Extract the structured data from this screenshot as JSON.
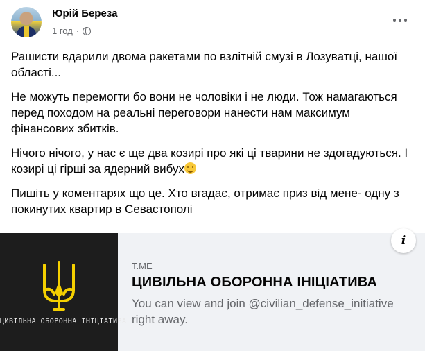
{
  "post": {
    "author": "Юрій Береза",
    "time": "1 год",
    "dot": "·",
    "paragraphs": [
      "Рашисти вдарили двома ракетами по взлітній смузі в Лозуватці, нашої області...",
      "Не можуть перемогти бо вони не чоловіки і не люди. Тож намагаються перед походом на реальні переговори нанести нам максимум фінансових збитків.",
      "Нічого нічого, у нас є ще два козирі про які ці тварини не здогадуються. І козирі ці гірші за ядерний вибух",
      "Пишіть у коментарях що це. Хто вгадає, отримає приз від мене- одну з покинутих квартир в Севастополі"
    ],
    "emoji": "smiling-face-icon"
  },
  "link_preview": {
    "domain": "T.ME",
    "title": "ЦИВІЛЬНА ОБОРОННА ІНІЦІАТИВА",
    "description": "You can view and join @civilian_defense_initiative right away.",
    "thumbnail_caption": "ЦИВІЛЬНА ОБОРОННА ІНІЦІАТИВА",
    "info_glyph": "i"
  },
  "colors": {
    "secondary_text": "#65676b",
    "trident": "#f5d000",
    "preview_bg": "#f0f2f5"
  }
}
